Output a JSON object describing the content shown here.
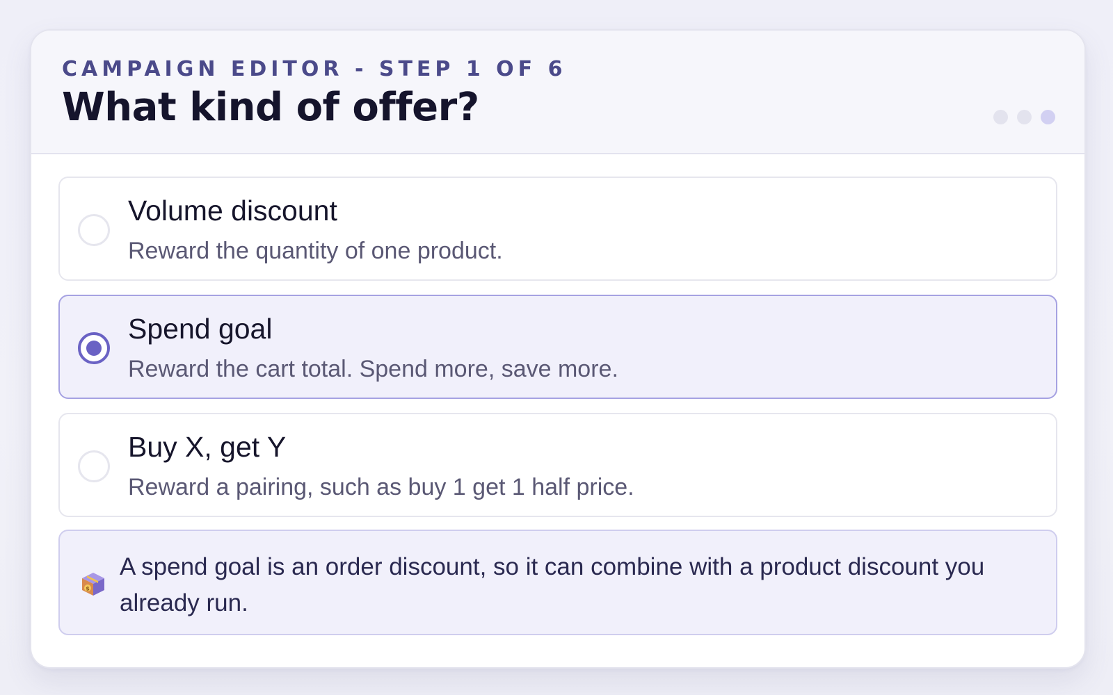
{
  "header": {
    "step_label": "CAMPAIGN EDITOR - STEP 1 OF 6",
    "title": "What kind of offer?",
    "dots": [
      {
        "state": "inactive"
      },
      {
        "state": "inactive"
      },
      {
        "state": "active"
      }
    ]
  },
  "options": [
    {
      "title": "Volume discount",
      "description": "Reward the quantity of one product.",
      "selected": false
    },
    {
      "title": "Spend goal",
      "description": "Reward the cart total. Spend more, save more.",
      "selected": true
    },
    {
      "title": "Buy X, get Y",
      "description": "Reward a pairing, such as buy 1 get 1 half price.",
      "selected": false
    }
  ],
  "note": {
    "icon": "gift-box-icon",
    "text": "A spend goal is an order discount, so it can combine with a product discount you already run."
  },
  "colors": {
    "accent": "#6a62c4",
    "selected_background": "#f1f0fb",
    "selected_border": "#a6a2e2",
    "heading": "#15142c",
    "step_label": "#4b4a8a"
  }
}
